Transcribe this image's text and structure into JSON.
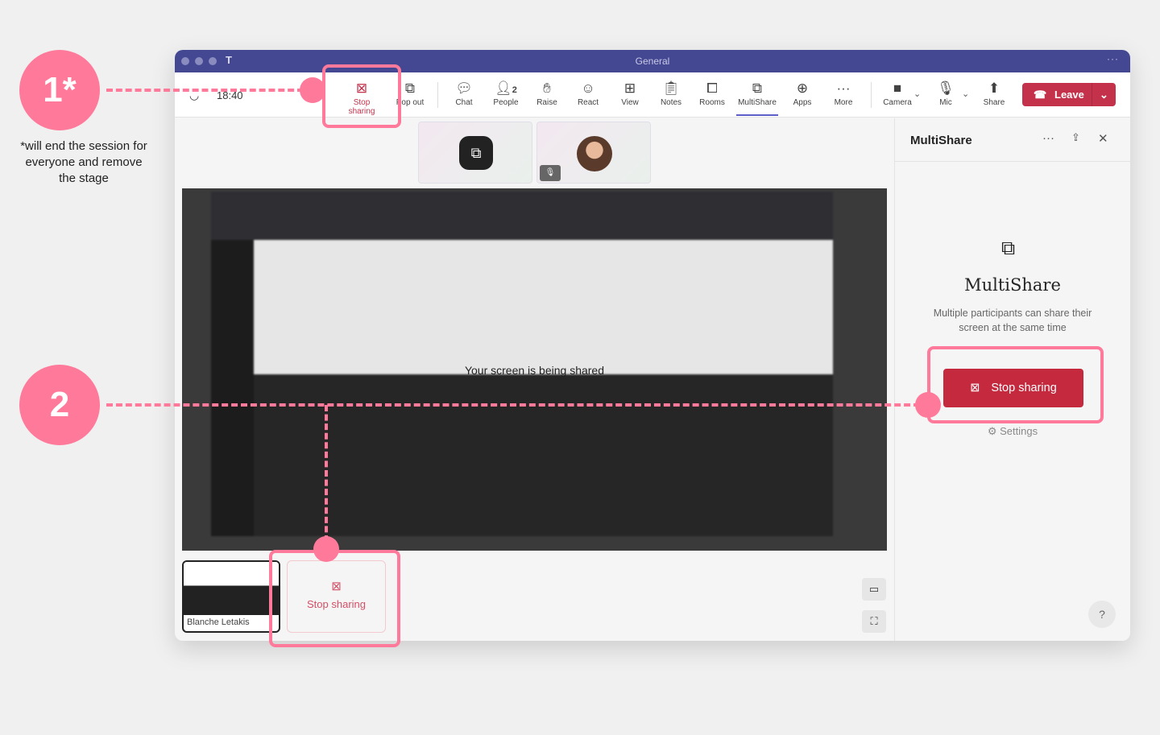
{
  "window": {
    "title": "General",
    "more": "···"
  },
  "toolbar": {
    "time": "18:40",
    "items": [
      {
        "label": "Stop sharing",
        "icon": "stop-sharing-icon"
      },
      {
        "label": "Pop out",
        "icon": "pop-out-icon"
      },
      {
        "label": "Chat",
        "icon": "chat-icon"
      },
      {
        "label": "People",
        "icon": "people-icon",
        "badge": "2"
      },
      {
        "label": "Raise",
        "icon": "hand-icon"
      },
      {
        "label": "React",
        "icon": "smiley-icon"
      },
      {
        "label": "View",
        "icon": "grid-icon"
      },
      {
        "label": "Notes",
        "icon": "notes-icon"
      },
      {
        "label": "Rooms",
        "icon": "rooms-icon"
      },
      {
        "label": "MultiShare",
        "icon": "multishare-icon"
      },
      {
        "label": "Apps",
        "icon": "plus-icon"
      },
      {
        "label": "More",
        "icon": "more-icon"
      },
      {
        "label": "Camera",
        "icon": "camera-off-icon"
      },
      {
        "label": "Mic",
        "icon": "mic-off-icon"
      },
      {
        "label": "Share",
        "icon": "share-icon"
      }
    ],
    "leave": "Leave"
  },
  "stage": {
    "shared_text": "Your screen is being shared"
  },
  "bottom": {
    "participant": "Blanche Letakis",
    "stop_sharing": "Stop sharing"
  },
  "panel": {
    "title": "MultiShare",
    "heading": "MultiShare",
    "description": "Multiple participants can share their screen at the same time",
    "stop_sharing": "Stop sharing",
    "settings": "Settings",
    "help": "?"
  },
  "annotations": {
    "one": "1*",
    "two": "2",
    "note": "*will end the session for everyone and remove the stage"
  },
  "colors": {
    "accent": "#444791",
    "leave": "#c4314b",
    "annotation": "#ff7a9a"
  }
}
